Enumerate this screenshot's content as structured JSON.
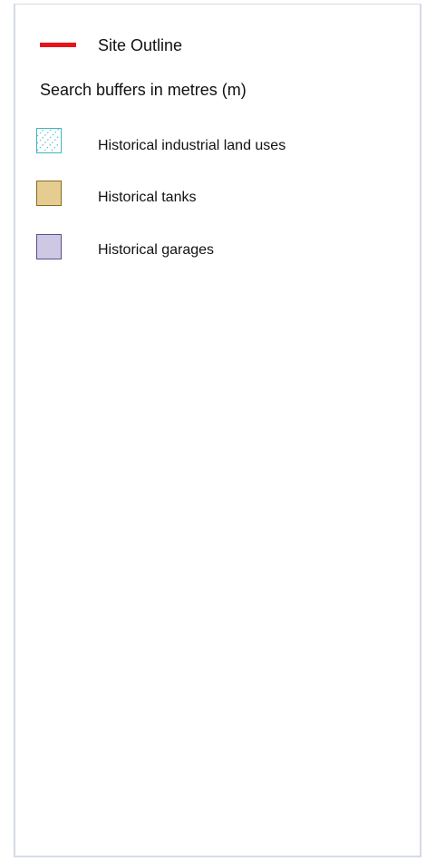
{
  "legend": {
    "site_outline": {
      "label": "Site Outline",
      "color": "#e8141a"
    },
    "buffers_label": "Search buffers in metres (m)",
    "items": [
      {
        "label": "Historical industrial land uses",
        "fill": "#ffffff",
        "stroke": "#3fb6c2",
        "pattern": "dotted-hatch"
      },
      {
        "label": "Historical tanks",
        "fill": "#e5cd92",
        "stroke": "#8a6a1e"
      },
      {
        "label": "Historical garages",
        "fill": "#cfc8e4",
        "stroke": "#5a4f8f"
      }
    ]
  }
}
